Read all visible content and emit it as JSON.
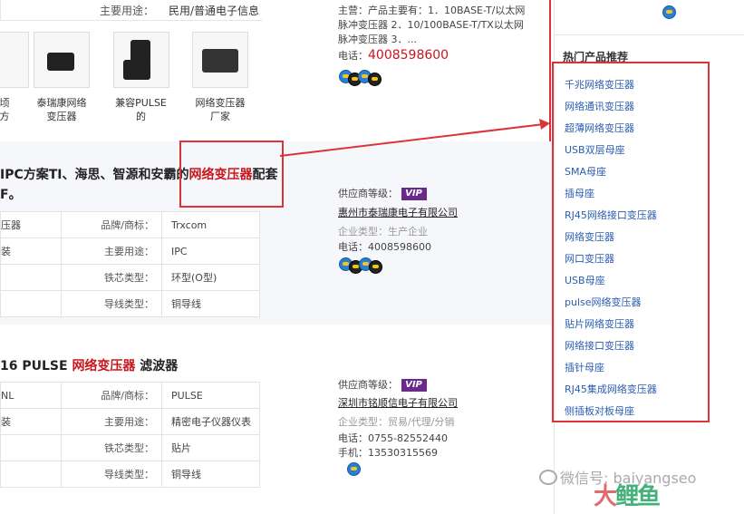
{
  "top_spec": {
    "key": "主要用途：",
    "value": "民用/普通电子信息"
  },
  "thumbnails": [
    {
      "caption_line1": "顷",
      "caption_line2": "方"
    },
    {
      "caption_line1": "泰瑞康网络",
      "caption_line2": "变压器"
    },
    {
      "caption_line1": "兼容PULSE",
      "caption_line2": "的"
    },
    {
      "caption_line1": "网络变压器",
      "caption_line2": "厂家"
    }
  ],
  "top_shop": {
    "main_line1": "主营：产品主要有：1．10BASE-T/以太网",
    "main_line2": "脉冲变压器 2．10/100BASE-T/TX以太网",
    "main_line3": "脉冲变压器 3．...",
    "phone_label": "电话：",
    "phone": "4008598600"
  },
  "product1": {
    "title_prefix": "IPC方案TI、海思、智源和安霸的",
    "title_highlight": "网络变压器",
    "title_suffix": "配套",
    "title_line2": "F。",
    "rows": [
      {
        "c0": "压器",
        "k": "品牌/商标：",
        "v": "Trxcom"
      },
      {
        "c0": "装",
        "k": "主要用途：",
        "v": "IPC"
      },
      {
        "c0": "",
        "k": "铁芯类型：",
        "v": "环型(O型)"
      },
      {
        "c0": "",
        "k": "导线类型：",
        "v": "铜导线"
      }
    ],
    "supplier_label": "供应商等级：",
    "vip": "VIP",
    "company": "惠州市泰瑞康电子有限公司",
    "etype": "企业类型：生产企业",
    "phone": "电话：4008598600"
  },
  "product2": {
    "title_prefix": "16 PULSE ",
    "title_highlight": "网络变压器",
    "title_suffix": " 滤波器",
    "rows": [
      {
        "c0": "NL",
        "k": "品牌/商标：",
        "v": "PULSE"
      },
      {
        "c0": "装",
        "k": "主要用途：",
        "v": "精密电子仪器仪表"
      },
      {
        "c0": "",
        "k": "铁芯类型：",
        "v": "贴片"
      },
      {
        "c0": "",
        "k": "导线类型：",
        "v": "铜导线"
      }
    ],
    "supplier_label": "供应商等级：",
    "vip": "VIP",
    "company": "深圳市铭顺信电子有限公司",
    "etype": "企业类型：贸易/代理/分销",
    "phone": "电话：0755-82552440",
    "mobile": "手机：13530315569"
  },
  "sidebar": {
    "title": "热门产品推荐",
    "items": [
      "千兆网络变压器",
      "网络通讯变压器",
      "超薄网络变压器",
      "USB双层母座",
      "SMA母座",
      "插母座",
      "RJ45网络接口变压器",
      "网络变压器",
      "网口变压器",
      "USB母座",
      "pulse网络变压器",
      "贴片网络变压器",
      "网络接口变压器",
      "插针母座",
      "RJ45集成网络变压器",
      "侧插板对板母座"
    ]
  },
  "watermark": {
    "text": "微信号: baiyangseo",
    "logo_a": "大",
    "logo_b": "鲤鱼"
  },
  "colors": {
    "highlight": "#c8161d",
    "frame": "#d9343a",
    "link": "#2a5db0"
  }
}
